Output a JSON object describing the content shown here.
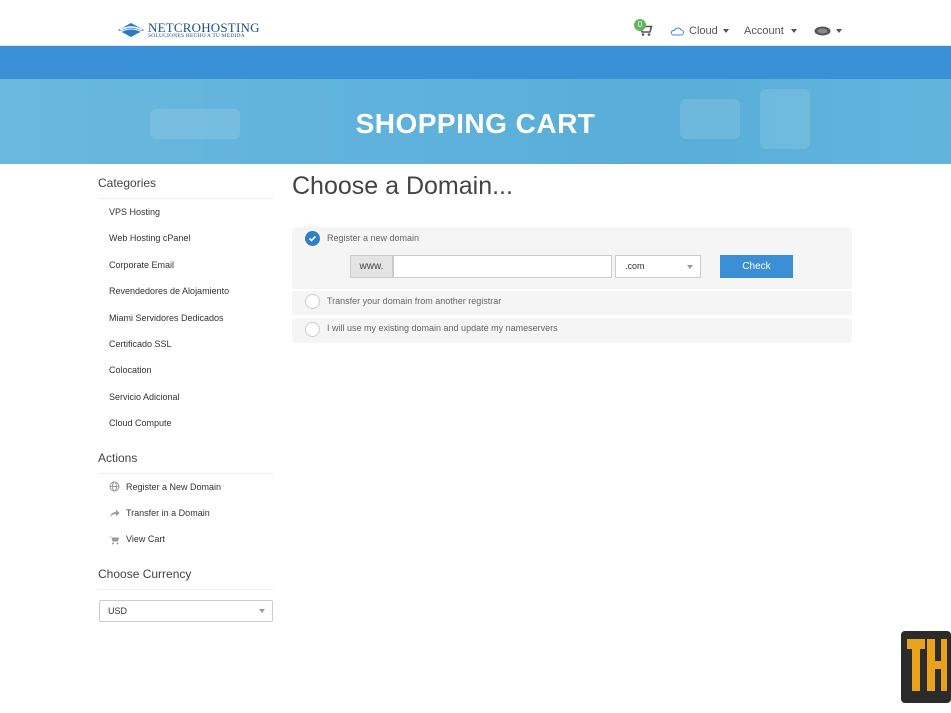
{
  "header": {
    "logo_name": "NETCROHOSTING",
    "logo_tagline": "SOLUCIONES HECHO A TU MEDIDA",
    "cart_count": "0",
    "nav_cloud": "Cloud",
    "nav_account": "Account"
  },
  "banner": {
    "title": "SHOPPING CART"
  },
  "sidebar": {
    "categories_heading": "Categories",
    "categories": [
      "VPS Hosting",
      "Web Hosting cPanel",
      "Corporate Email",
      "Revendedores de Alojamiento",
      "Miami Servidores Dedicados",
      "Certificado SSL",
      "Colocation",
      "Servicio Adicional",
      "Cloud Compute"
    ],
    "actions_heading": "Actions",
    "actions": [
      {
        "label": "Register a New Domain",
        "icon": "globe-icon"
      },
      {
        "label": "Transfer in a Domain",
        "icon": "share-arrow-icon"
      },
      {
        "label": "View Cart",
        "icon": "cart-icon"
      }
    ],
    "currency_heading": "Choose Currency",
    "currency_value": "USD"
  },
  "main": {
    "title": "Choose a Domain...",
    "options": [
      {
        "label": "Register a new domain",
        "selected": true
      },
      {
        "label": "Transfer your domain from another registrar",
        "selected": false
      },
      {
        "label": "I will use my existing domain and update my nameservers",
        "selected": false
      }
    ],
    "www_prefix": "www.",
    "domain_value": "",
    "tld_value": ".com",
    "check_label": "Check"
  },
  "colors": {
    "accent": "#3a8fd6",
    "banner": "#5fb2dc",
    "badge": "#5cb85c",
    "logo": "#1a4f8b"
  }
}
